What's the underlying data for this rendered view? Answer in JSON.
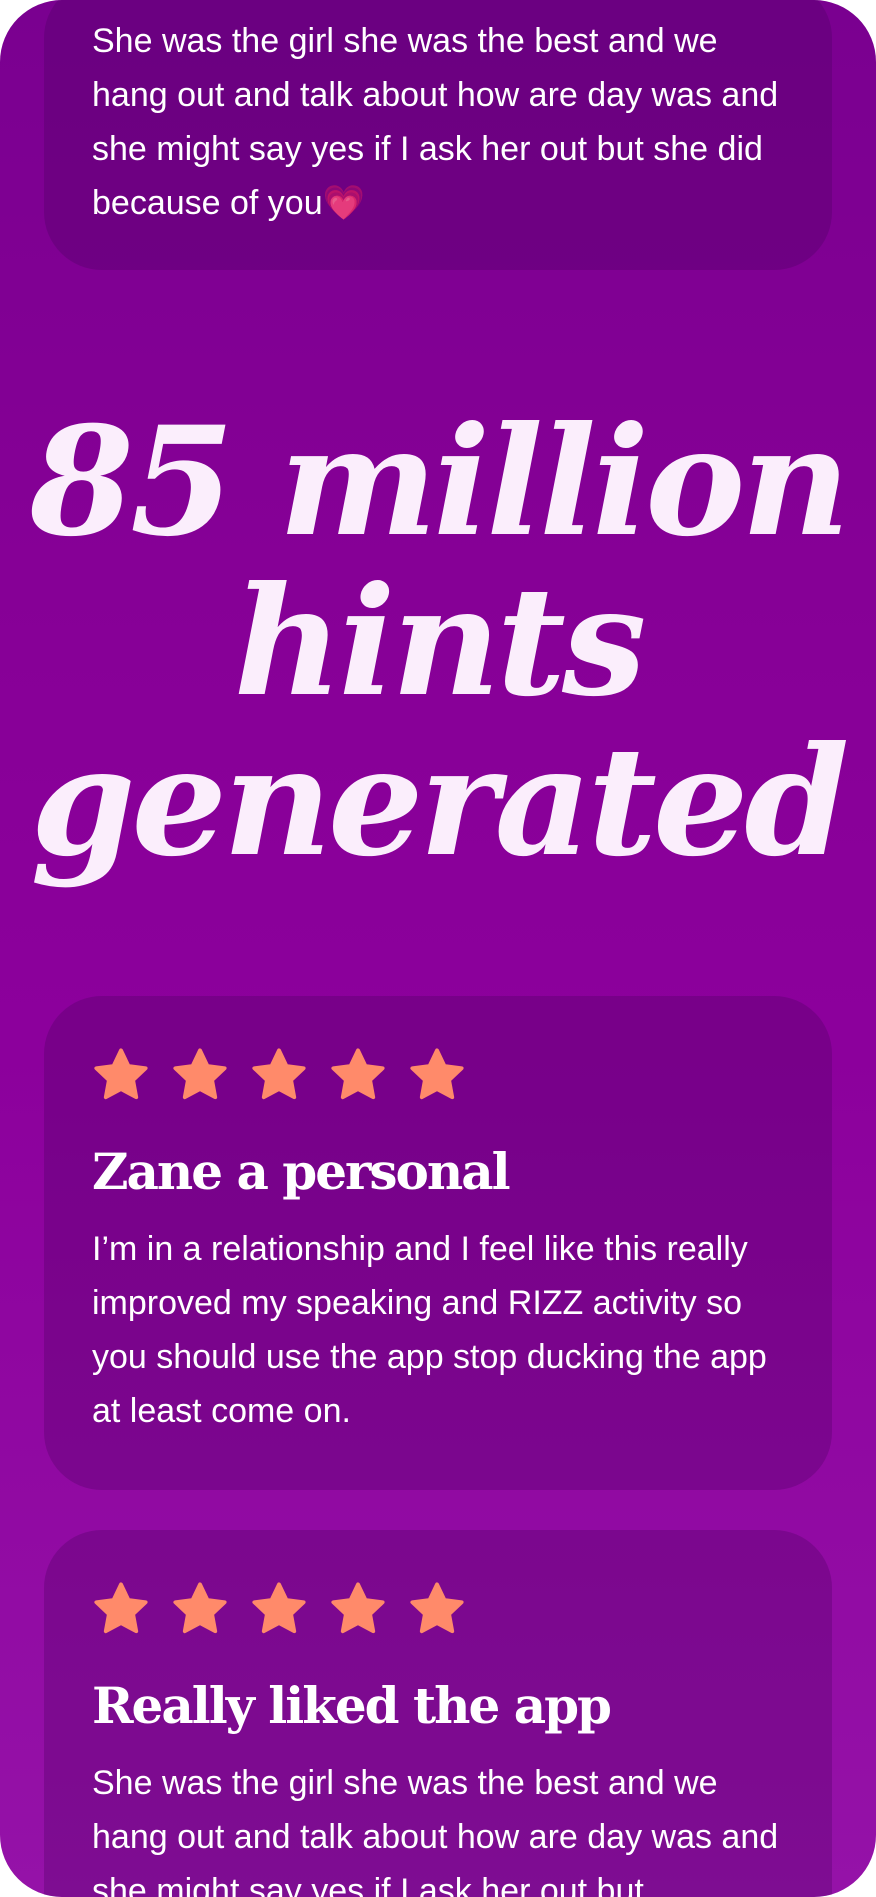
{
  "reviews": [
    {
      "title": "",
      "body": "She was the girl she was the best and we hang out and talk about how are day was and she might say yes if I ask her out but she did because of you💗",
      "stars": 0
    },
    {
      "title": "Zane a personal",
      "body": "I’m in a relationship and I feel like this really improved my speaking and RIZZ activity so you should use the app stop ducking the app at least come on.",
      "stars": 5
    },
    {
      "title": "Really liked the app",
      "body": "She was the girl she was the best and we hang out and talk about how are day was and she might say yes if I ask her out but",
      "stars": 5
    }
  ],
  "headline": {
    "line1": "85 million",
    "line2": "hints",
    "line3": "generated"
  },
  "colors": {
    "background_top": "#7a0090",
    "background_bottom": "#9512a8",
    "star": "#ff8a6a",
    "headline_text": "#fbeefc"
  },
  "icons": {
    "rating": "star-icon"
  }
}
